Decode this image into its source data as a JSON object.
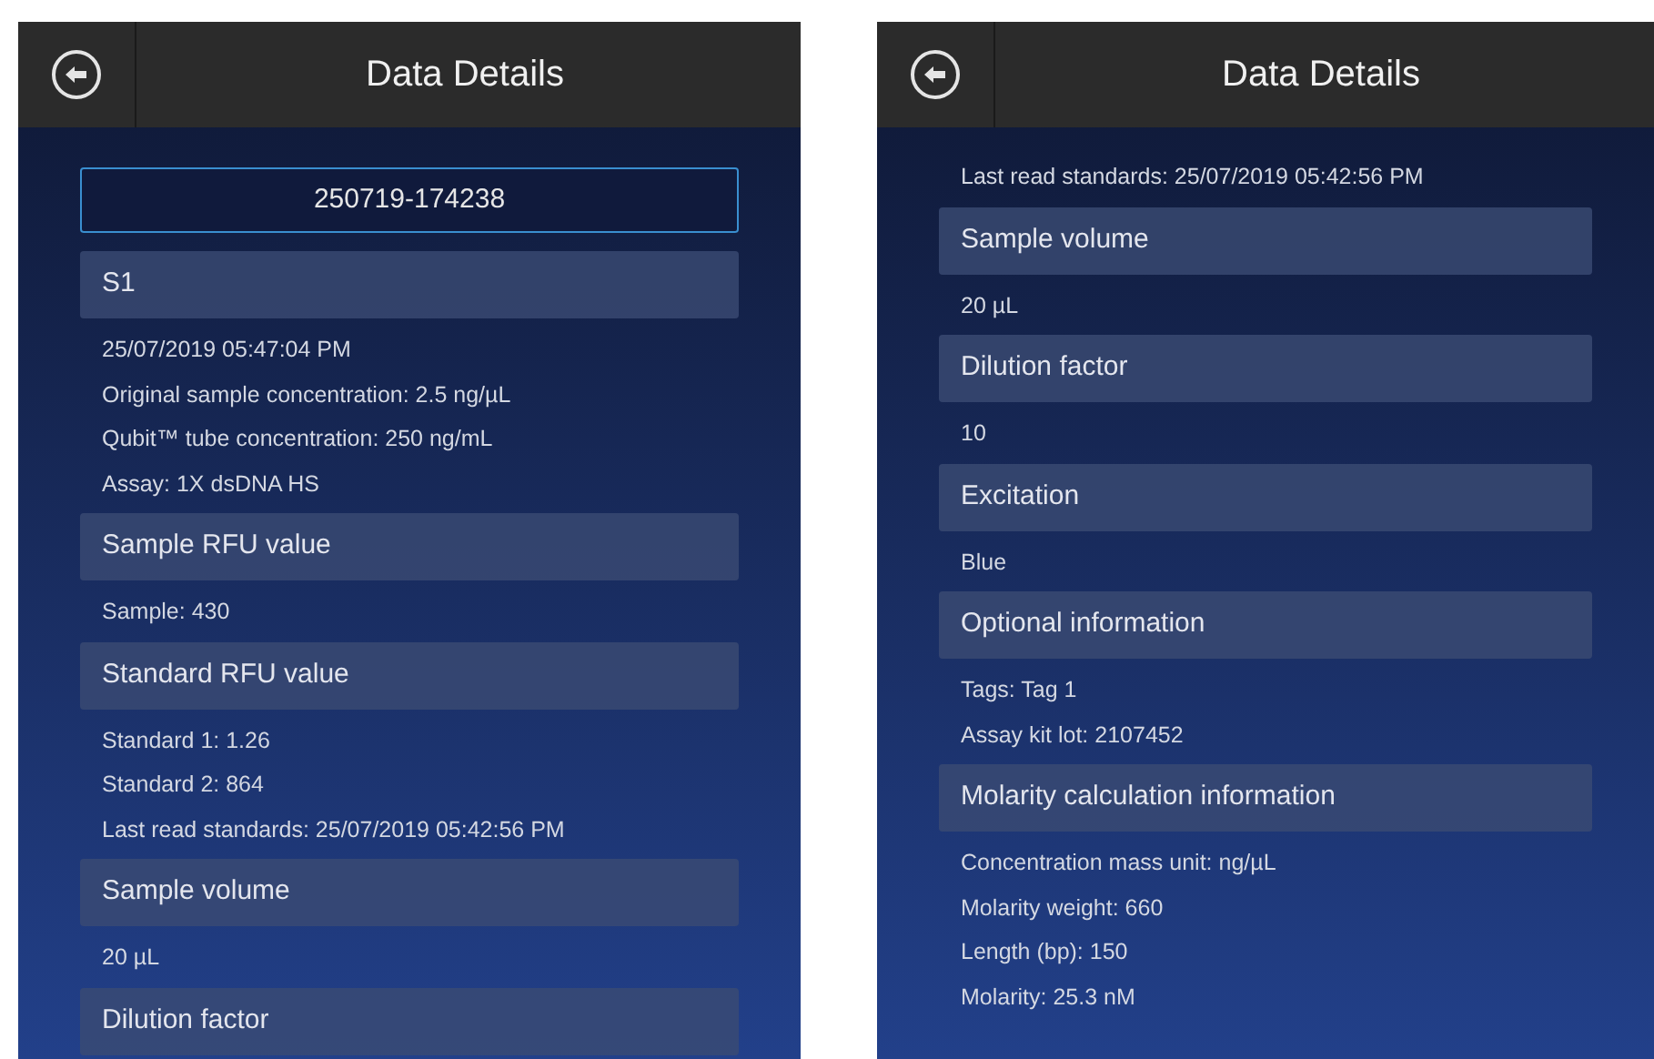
{
  "screens": [
    {
      "title": "Data Details",
      "record_id": "250719-174238",
      "sections": [
        {
          "heading": "S1",
          "lines": [
            "25/07/2019 05:47:04 PM",
            "Original sample concentration: 2.5 ng/µL",
            "Qubit™ tube concentration: 250 ng/mL",
            "Assay: 1X dsDNA HS"
          ]
        },
        {
          "heading": "Sample RFU value",
          "lines": [
            "Sample: 430"
          ]
        },
        {
          "heading": "Standard RFU value",
          "lines": [
            "Standard 1: 1.26",
            "Standard 2: 864",
            "Last read standards: 25/07/2019 05:42:56 PM"
          ]
        },
        {
          "heading": "Sample volume",
          "lines": [
            "20 µL"
          ]
        },
        {
          "heading": "Dilution factor"
        }
      ]
    },
    {
      "title": "Data Details",
      "sections": [
        {
          "lines": [
            "Last read standards: 25/07/2019 05:42:56 PM"
          ]
        },
        {
          "heading": "Sample volume",
          "lines": [
            "20 µL"
          ]
        },
        {
          "heading": "Dilution factor",
          "lines": [
            "10"
          ]
        },
        {
          "heading": "Excitation",
          "lines": [
            "Blue"
          ]
        },
        {
          "heading": "Optional information",
          "lines": [
            "Tags: Tag 1",
            "Assay kit lot: 2107452"
          ]
        },
        {
          "heading": "Molarity calculation information",
          "lines": [
            "Concentration mass unit: ng/µL",
            "Molarity weight: 660",
            "Length (bp): 150",
            "Molarity: 25.3 nM"
          ]
        }
      ]
    }
  ]
}
